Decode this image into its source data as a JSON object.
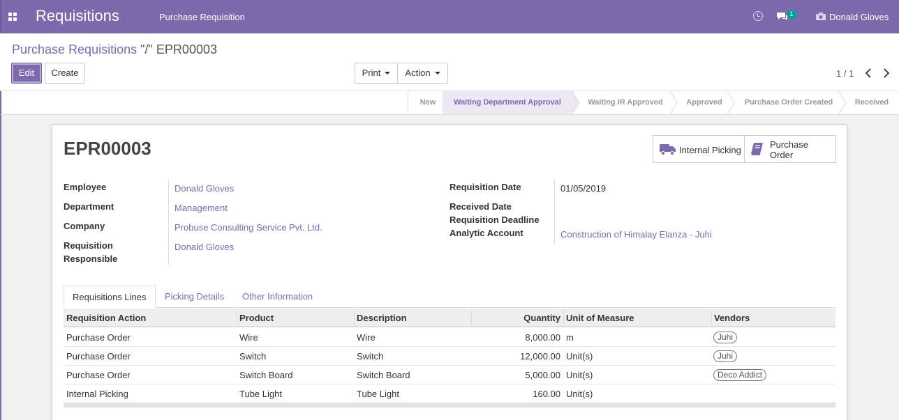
{
  "navbar": {
    "app_title": "Requisitions",
    "menu_item": "Purchase Requisition",
    "notification_count": "1",
    "user_name": "Donald Gloves"
  },
  "breadcrumb": {
    "parent": "Purchase Requisitions",
    "separator": "\"/\"",
    "current": "EPR00003"
  },
  "buttons": {
    "edit": "Edit",
    "create": "Create",
    "print": "Print",
    "action": "Action"
  },
  "pager": {
    "value": "1 / 1"
  },
  "statusbar": {
    "stages": [
      "New",
      "Waiting Department Approval",
      "Waiting IR Approved",
      "Approved",
      "Purchase Order Created",
      "Received"
    ],
    "active_stage": "Waiting Department Approval"
  },
  "form": {
    "title": "EPR00003",
    "smart_buttons": {
      "internal_picking": "Internal Picking",
      "purchase_order_line1": "Purchase",
      "purchase_order_line2": "Order"
    },
    "left": {
      "employee_label": "Employee",
      "employee_value": "Donald Gloves",
      "department_label": "Department",
      "department_value": "Management",
      "company_label": "Company",
      "company_value": "Probuse Consulting Service Pvt. Ltd.",
      "responsible_label_line1": "Requisition",
      "responsible_label_line2": "Responsible",
      "responsible_value": "Donald Gloves"
    },
    "right": {
      "req_date_label": "Requisition Date",
      "req_date_value": "01/05/2019",
      "received_date_label": "Received Date",
      "deadline_label": "Requisition Deadline",
      "analytic_label": "Analytic Account",
      "analytic_value": "Construction of Himalay Elanza - Juhi"
    }
  },
  "tabs": [
    "Requisitions Lines",
    "Picking Details",
    "Other Information"
  ],
  "table": {
    "headers": [
      "Requisition Action",
      "Product",
      "Description",
      "Quantity",
      "Unit of Measure",
      "Vendors"
    ],
    "rows": [
      {
        "action": "Purchase Order",
        "product": "Wire",
        "description": "Wire",
        "quantity": "8,000.00",
        "uom": "m",
        "vendor": "Juhi"
      },
      {
        "action": "Purchase Order",
        "product": "Switch",
        "description": "Switch",
        "quantity": "12,000.00",
        "uom": "Unit(s)",
        "vendor": "Juhi"
      },
      {
        "action": "Purchase Order",
        "product": "Switch Board",
        "description": "Switch Board",
        "quantity": "5,000.00",
        "uom": "Unit(s)",
        "vendor": "Deco Addict"
      },
      {
        "action": "Internal Picking",
        "product": "Tube Light",
        "description": "Tube Light",
        "quantity": "160.00",
        "uom": "Unit(s)",
        "vendor": ""
      }
    ]
  },
  "colors": {
    "brand": "#7c6aad",
    "active_stage_bg": "#ece9f4",
    "badge": "#00a09d"
  }
}
